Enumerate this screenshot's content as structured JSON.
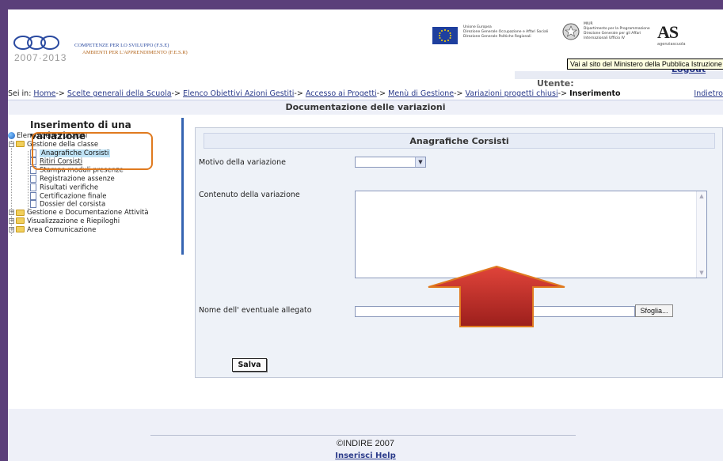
{
  "header": {
    "logo_years": "2007·2013",
    "logo_line1": "COMPETENZE PER LO SVILUPPO (F.S.E)",
    "logo_line2": "AMBIENTI PER L'APPRENDIMENTO (F.E.S.R)",
    "eu_text": "Unione Europea\nDirezione Generale Occupazione e Affari Sociali\nDirezione Generale Politiche Regionali",
    "miur_text": "MIUR\nDipartimento per la Programmazione\nDirezione Generale per gli Affari\nInternazionali Ufficio IV",
    "as_logo": "AS",
    "as_sub": "agenziascuola",
    "tooltip": "Vai al sito del Ministero della Pubblica Istruzione",
    "logout": "Logout",
    "user_label": "Utente:"
  },
  "breadcrumb": {
    "prefix": "Sei in: ",
    "items": [
      "Home",
      "Scelte generali della Scuola",
      "Elenco Obiettivi Azioni Gestiti",
      "Accesso ai Progetti",
      "Menù di Gestione",
      "Variazioni progetti chiusi"
    ],
    "separator": "-> ",
    "current": "Inserimento",
    "back": "Indietro"
  },
  "doc_title": "Documentazione delle variazioni",
  "sidebar": {
    "title": "Inserimento di una variazione",
    "root": "Elenco delle Funzioni",
    "group1": "Gestione della classe",
    "items": [
      "Anagrafiche Corsisti",
      "Ritiri Corsisti",
      "Stampa moduli presenze",
      "Registrazione assenze",
      "Risultati verifiche",
      "Certificazione finale",
      "Dossier del corsista"
    ],
    "groups": [
      "Gestione e Documentazione Attività",
      "Visualizzazione e Riepiloghi",
      "Area Comunicazione"
    ]
  },
  "form": {
    "header": "Anagrafiche Corsisti",
    "motivo_label": "Motivo della variazione",
    "motivo_value": "",
    "contenuto_label": "Contenuto della variazione",
    "contenuto_value": "",
    "allegato_label": "Nome dell' eventuale allegato",
    "allegato_value": "",
    "browse_label": "Sfoglia...",
    "save_label": "Salva"
  },
  "footer": {
    "copyright": "©INDIRE 2007",
    "help": "Inserisci Help"
  },
  "colors": {
    "frame": "#5b3f7a",
    "link": "#2a3a8a",
    "highlight_box": "#e07a1f",
    "arrow": "#c0302a",
    "sidebar_rule": "#3564b2"
  }
}
